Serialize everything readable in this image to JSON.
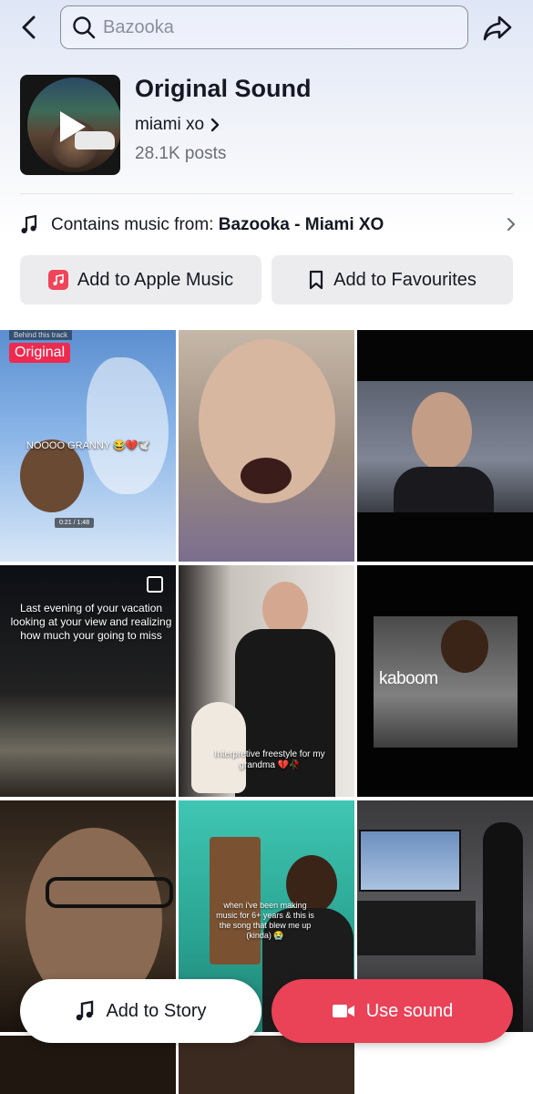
{
  "search": {
    "placeholder": "Bazooka"
  },
  "sound": {
    "title": "Original Sound",
    "artist": "miami xo",
    "posts": "28.1K posts"
  },
  "music_info": {
    "prefix": "Contains music from: ",
    "track": "Bazooka - Miami XO"
  },
  "actions": {
    "apple_music": "Add to Apple Music",
    "favourites": "Add to Favourites"
  },
  "videos": [
    {
      "badge": "Original",
      "overlay": "Behind this track",
      "caption": "NOOOO GRANNY 😂💔🕊️",
      "time": "0:21 / 1:48"
    },
    {
      "caption": ""
    },
    {
      "caption": ""
    },
    {
      "caption": "Last evening of your vacation looking at your view and realizing how much your going to miss"
    },
    {
      "caption": "Interpretive freestyle for my grandma 💔🥀"
    },
    {
      "caption": "kaboom"
    },
    {
      "caption": ""
    },
    {
      "caption": "when i've been making music for 6+ years & this is the song that blew me up (kinda) 😭"
    },
    {
      "caption": ""
    }
  ],
  "bottom": {
    "story": "Add to Story",
    "use_sound": "Use sound"
  },
  "colors": {
    "accent": "#ea4257",
    "badge": "#ee2a4f",
    "muted": "#6b6e78"
  },
  "icons": [
    "back-arrow-icon",
    "search-icon",
    "share-icon",
    "play-icon",
    "chevron-right-icon",
    "music-note-icon",
    "apple-music-icon",
    "bookmark-icon",
    "video-camera-icon"
  ]
}
